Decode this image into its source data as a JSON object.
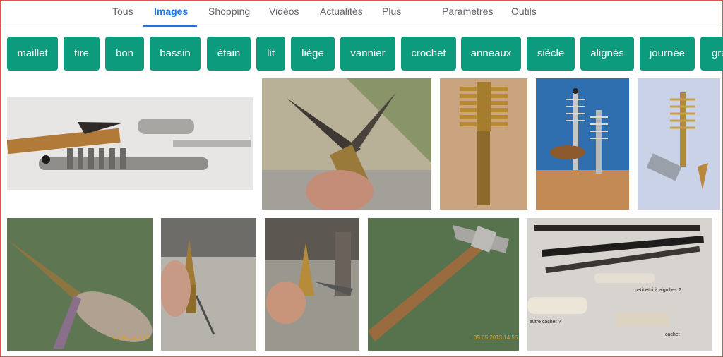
{
  "nav": {
    "tabs": [
      {
        "label": "Tous"
      },
      {
        "label": "Images"
      },
      {
        "label": "Shopping"
      },
      {
        "label": "Vidéos"
      },
      {
        "label": "Actualités"
      },
      {
        "label": "Plus"
      }
    ],
    "settings_label": "Paramètres",
    "tools_label": "Outils",
    "active_tab": "Images",
    "accent_color": "#1a73e8"
  },
  "chips": {
    "color": "#0d9b7e",
    "items": [
      "maillet",
      "tire",
      "bon",
      "bassin",
      "étain",
      "lit",
      "liège",
      "vannier",
      "crochet",
      "anneaux",
      "siècle",
      "alignés",
      "journée",
      "gra"
    ]
  },
  "results": {
    "image_labels": {
      "label_a": "petit étui à aiguilles ?",
      "label_b": "autre cachet ?",
      "label_c": "cachet"
    },
    "date_stamp": "05.05.2013 14:",
    "date_stamp_2": "05.05.2013 14:56"
  }
}
